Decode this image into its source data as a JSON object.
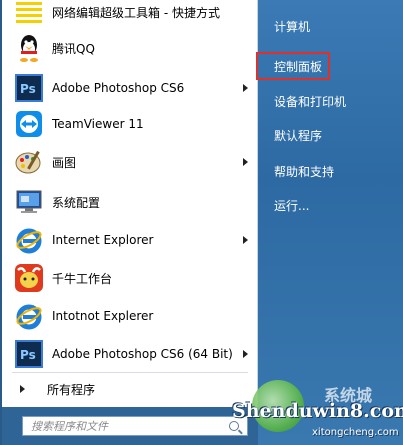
{
  "programs": [
    {
      "label": "网络编辑超级工具箱 - 快捷方式",
      "icon": "toolbox-icon",
      "has_arrow": false
    },
    {
      "label": "腾讯QQ",
      "icon": "qq-penguin-icon",
      "has_arrow": false
    },
    {
      "label": "Adobe Photoshop CS6",
      "icon": "photoshop-icon",
      "has_arrow": true
    },
    {
      "label": "TeamViewer 11",
      "icon": "teamviewer-icon",
      "has_arrow": false
    },
    {
      "label": "画图",
      "icon": "paint-palette-icon",
      "has_arrow": true
    },
    {
      "label": "系统配置",
      "icon": "system-config-icon",
      "has_arrow": false
    },
    {
      "label": "Internet Explorer",
      "icon": "internet-explorer-icon",
      "has_arrow": true
    },
    {
      "label": "千牛工作台",
      "icon": "qianniu-icon",
      "has_arrow": false
    },
    {
      "label": "Intotnot  Explerer",
      "icon": "internet-explorer-icon",
      "has_arrow": false
    },
    {
      "label": "Adobe Photoshop CS6 (64 Bit)",
      "icon": "photoshop-icon",
      "has_arrow": true
    }
  ],
  "all_programs_label": "所有程序",
  "search": {
    "placeholder": "搜索程序和文件"
  },
  "system_items": [
    {
      "label": "计算机"
    },
    {
      "label": "控制面板",
      "highlighted": true
    },
    {
      "label": "设备和打印机"
    },
    {
      "label": "默认程序"
    },
    {
      "label": "帮助和支持"
    },
    {
      "label": "运行..."
    }
  ],
  "watermark": {
    "main": "Shenduwin8.com",
    "sub": "xitongcheng.com",
    "top": "系统城"
  },
  "colors": {
    "highlight_border": "#e0302a",
    "right_pane": "#2d6aa3"
  }
}
